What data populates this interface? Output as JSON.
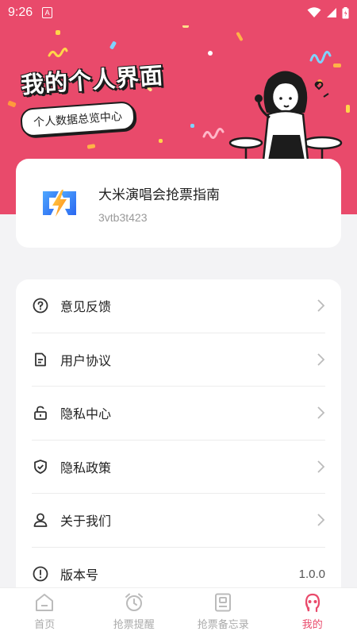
{
  "status_bar": {
    "time": "9:26",
    "badge": "A"
  },
  "hero": {
    "title": "我的个人界面",
    "subtitle": "个人数据总览中心"
  },
  "app": {
    "name": "大米演唱会抢票指南",
    "id": "3vtb3t423"
  },
  "menu": {
    "items": [
      {
        "label": "意见反馈",
        "icon": "help-circle-icon"
      },
      {
        "label": "用户协议",
        "icon": "document-icon"
      },
      {
        "label": "隐私中心",
        "icon": "unlock-icon"
      },
      {
        "label": "隐私政策",
        "icon": "shield-check-icon"
      },
      {
        "label": "关于我们",
        "icon": "user-icon"
      },
      {
        "label": "版本号",
        "icon": "info-icon",
        "value": "1.0.0"
      }
    ]
  },
  "tabs": [
    {
      "label": "首页",
      "icon": "home-icon"
    },
    {
      "label": "抢票提醒",
      "icon": "alarm-clock-icon"
    },
    {
      "label": "抢票备忘录",
      "icon": "memo-icon"
    },
    {
      "label": "我的",
      "icon": "profile-icon",
      "active": true
    }
  ],
  "colors": {
    "accent": "#e94a6b",
    "background": "#f3f3f5",
    "card": "#ffffff"
  }
}
